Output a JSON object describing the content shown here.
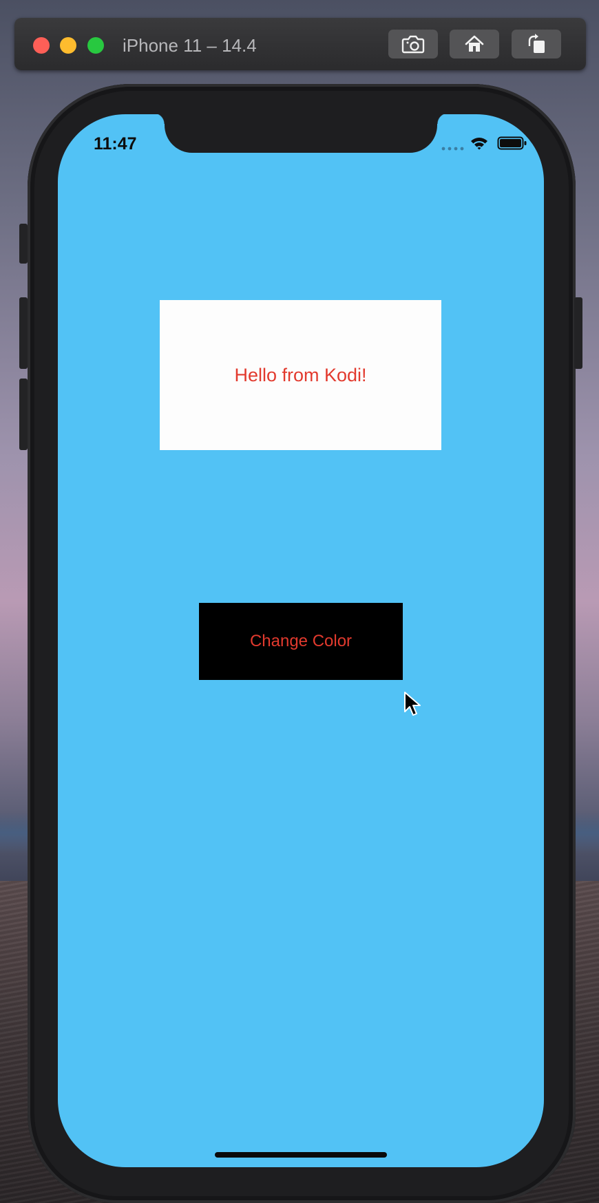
{
  "window": {
    "title": "iPhone 11 – 14.4",
    "toolbar_icons": [
      "screenshot-icon",
      "home-icon",
      "rotate-icon"
    ]
  },
  "status_bar": {
    "time": "11:47",
    "icons": [
      "signal-icon",
      "wifi-icon",
      "battery-icon"
    ]
  },
  "main": {
    "hello_text": "Hello from Kodi!",
    "change_button_label": "Change Color"
  },
  "colors": {
    "screen_background": "#52c2f5",
    "label_text": "#e23a2e",
    "hello_box": "#fdfdfd",
    "button_background": "#000000"
  }
}
